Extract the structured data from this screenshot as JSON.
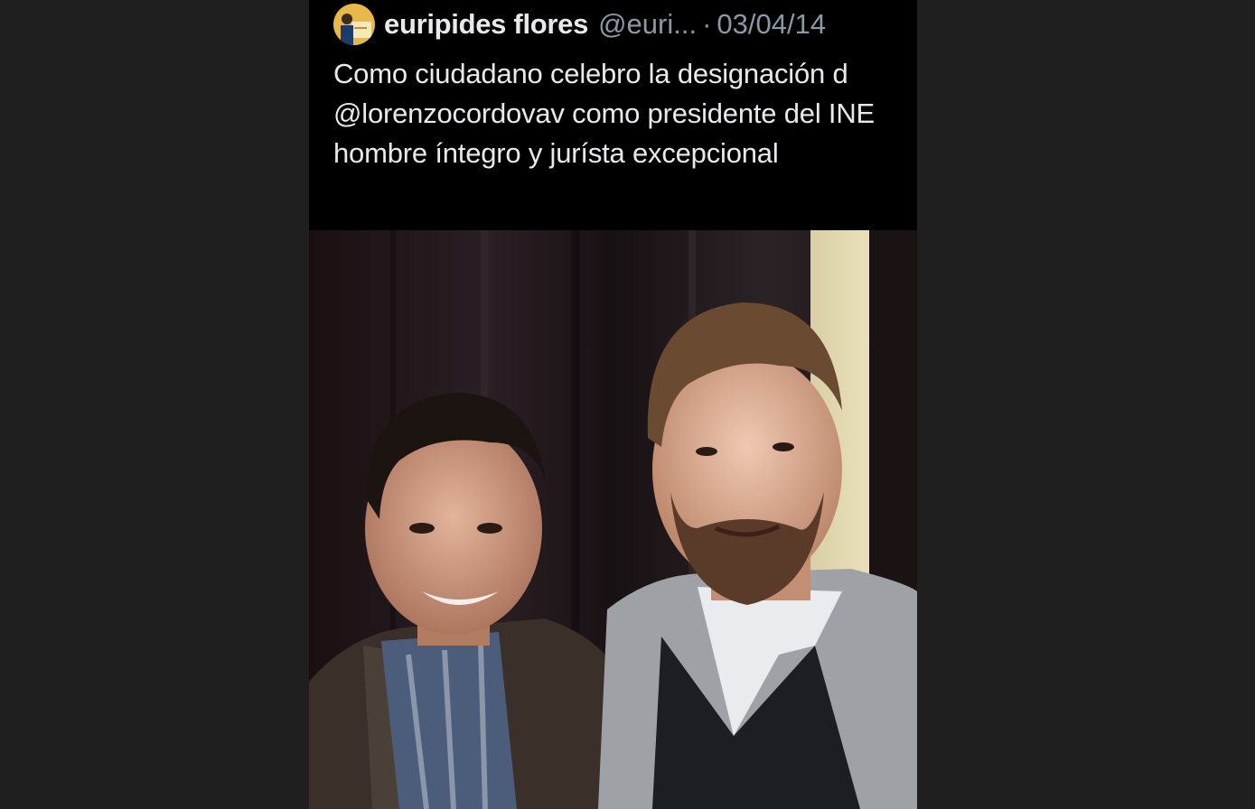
{
  "tweet": {
    "author_name": "euripides flores",
    "handle": "@euri...",
    "separator": "·",
    "date": "03/04/14",
    "text": "Como ciudadano celebro la designación d @lorenzocordovav como presidente del INE hombre íntegro y jurísta excepcional"
  },
  "colors": {
    "background": "#1f1f1f",
    "card": "#000000",
    "text": "#e7e9ea",
    "muted": "#8b98a5"
  }
}
